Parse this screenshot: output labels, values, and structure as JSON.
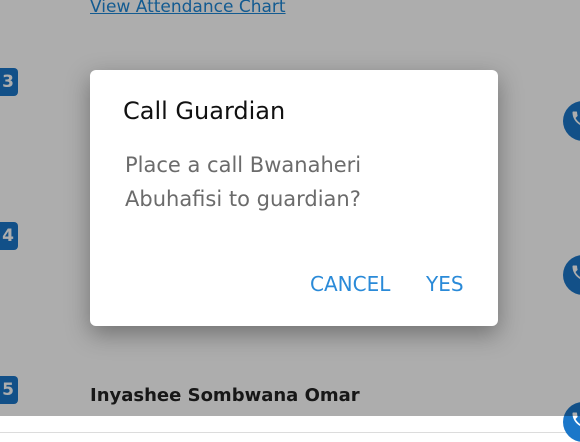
{
  "list": {
    "attendance_link": "View Attendance Chart",
    "rows": [
      {
        "number": "3",
        "name": "",
        "detail": ""
      },
      {
        "number": "4",
        "name": "",
        "detail": ""
      },
      {
        "number": "5",
        "name": "Inyashee Sombwana Omar"
      }
    ]
  },
  "dialog": {
    "title": "Call Guardian",
    "message": "Place a call Bwanaheri Abuhafisi to guardian?",
    "cancel_label": "CANCEL",
    "yes_label": "YES"
  },
  "colors": {
    "accent": "#1b77c9",
    "button_text": "#2a8ad8",
    "overlay": "rgba(0,0,0,0.32)"
  },
  "icons": {
    "call": "phone-icon"
  }
}
